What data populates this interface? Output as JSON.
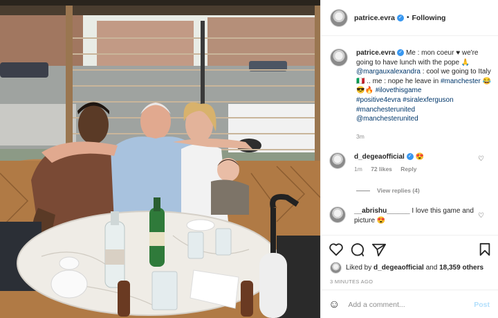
{
  "post": {
    "image_alt": "",
    "header": {
      "username": "patrice.evra",
      "verified_icon": "verified-badge-icon",
      "follow_status": "Following"
    },
    "caption": {
      "username": "patrice.evra",
      "text_1": "Me : mon coeur ♥ we're going to have lunch with the pope 🙏",
      "mention_1": "@margauxalexandra",
      "text_2": ": cool we going to Italy 🇮🇹 .. me : nope he leave in",
      "hashtag_1": "#manchester",
      "emojis": "😂😎🔥",
      "hashtag_2": "#ilovethisgame",
      "hashtag_3": "#positive4evra",
      "hashtag_4": "#siralexferguson",
      "hashtag_5": "#manchesterunited",
      "mention_2": "@manchesterunited",
      "time": "3m"
    },
    "comments": [
      {
        "username": "d_degeaofficial",
        "emoji": "😍",
        "text": "",
        "time": "1m",
        "likes": "72 likes",
        "reply": "Reply",
        "view_replies": "View replies (4)"
      },
      {
        "username": "__abrishu______",
        "text": "I love this game and picture 😍"
      }
    ],
    "actions": {
      "like_icon": "heart-icon",
      "comment_icon": "comment-icon",
      "share_icon": "paper-plane-icon",
      "save_icon": "bookmark-icon"
    },
    "liked_by": {
      "prefix": "Liked by",
      "user": "d_degeaofficial",
      "middle": "and",
      "count": "18,359 others"
    },
    "timestamp": "3 MINUTES AGO",
    "add_comment": {
      "placeholder": "Add a comment...",
      "post_label": "Post"
    }
  }
}
